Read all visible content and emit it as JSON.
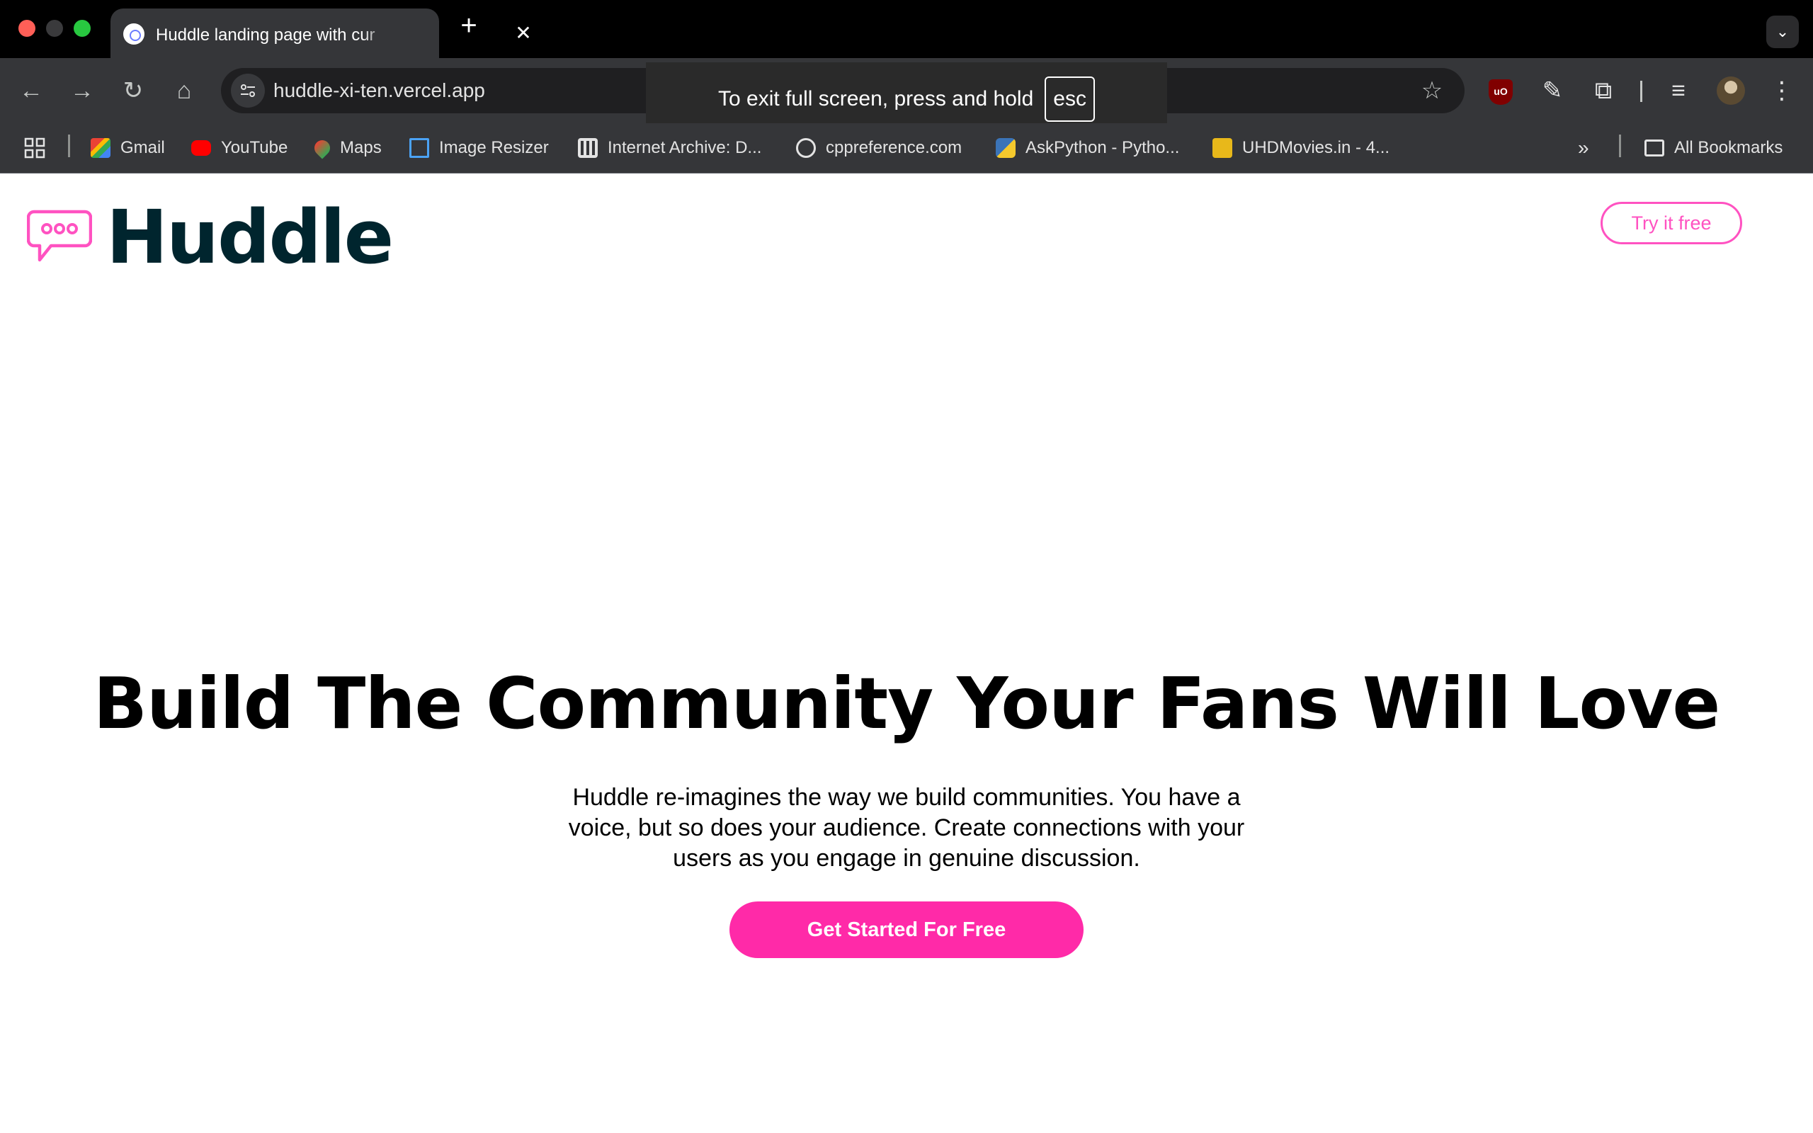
{
  "browser": {
    "tab_title": "Huddle landing page with cur",
    "tab_close": "✕",
    "new_tab": "+",
    "url": "huddle-xi-ten.vercel.app",
    "fullscreen_toast": {
      "message": "To exit full screen, press and hold",
      "key": "esc"
    },
    "bookmarks": [
      {
        "label": "Gmail",
        "icon": "gmail-icon"
      },
      {
        "label": "YouTube",
        "icon": "youtube-icon"
      },
      {
        "label": "Maps",
        "icon": "maps-icon"
      },
      {
        "label": "Image Resizer",
        "icon": "image-resizer-icon"
      },
      {
        "label": "Internet Archive: D...",
        "icon": "internet-archive-icon"
      },
      {
        "label": "cppreference.com",
        "icon": "cppreference-icon"
      },
      {
        "label": "AskPython - Pytho...",
        "icon": "askpython-icon"
      },
      {
        "label": "UHDMovies.in - 4...",
        "icon": "uhdmovies-icon"
      }
    ],
    "all_bookmarks": "All Bookmarks"
  },
  "page": {
    "logo_text": "Huddle",
    "try_button": "Try it free",
    "hero_title": "Build The Community Your Fans Will Love",
    "hero_text": "Huddle re-imagines the way we build communities. You have a voice, but so does your audience. Create connections with your users as you engage in genuine discussion.",
    "cta_button": "Get Started For Free"
  },
  "colors": {
    "brand_pink": "#ff52c1",
    "cta_pink": "#ff2aa8",
    "logo_text": "#00252e"
  }
}
